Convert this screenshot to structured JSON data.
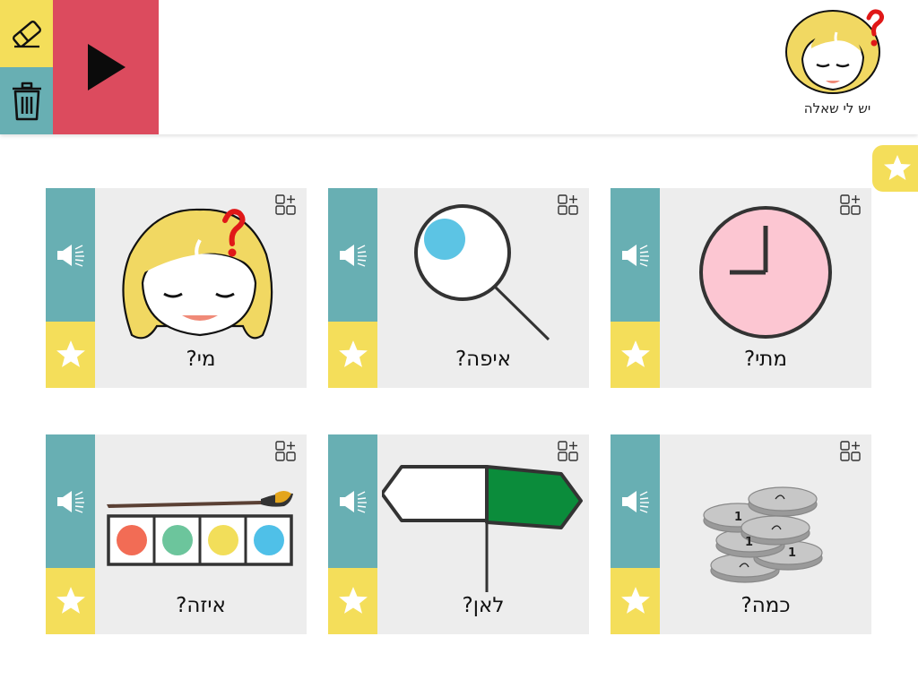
{
  "header": {
    "category_title": "יש לי שאלה",
    "colors": {
      "eraser": "#F4DE5A",
      "trash": "#68AFB3",
      "play": "#DC4B5E"
    },
    "icons": {
      "eraser": "eraser-icon",
      "trash": "trash-icon",
      "play": "play-icon",
      "category": "girl-question-icon"
    }
  },
  "favorites_tab": {
    "icon": "star-icon"
  },
  "cards": [
    {
      "label": "מתי?",
      "image": "clock-icon"
    },
    {
      "label": "איפה?",
      "image": "magnifier-icon"
    },
    {
      "label": "מי?",
      "image": "girl-question-icon"
    },
    {
      "label": "כמה?",
      "image": "coins-icon"
    },
    {
      "label": "לאן?",
      "image": "signpost-icon"
    },
    {
      "label": "איזה?",
      "image": "palette-icon"
    }
  ],
  "card_icons": {
    "speak": "speaker-icon",
    "favorite": "star-icon",
    "open": "grid-plus-icon"
  }
}
